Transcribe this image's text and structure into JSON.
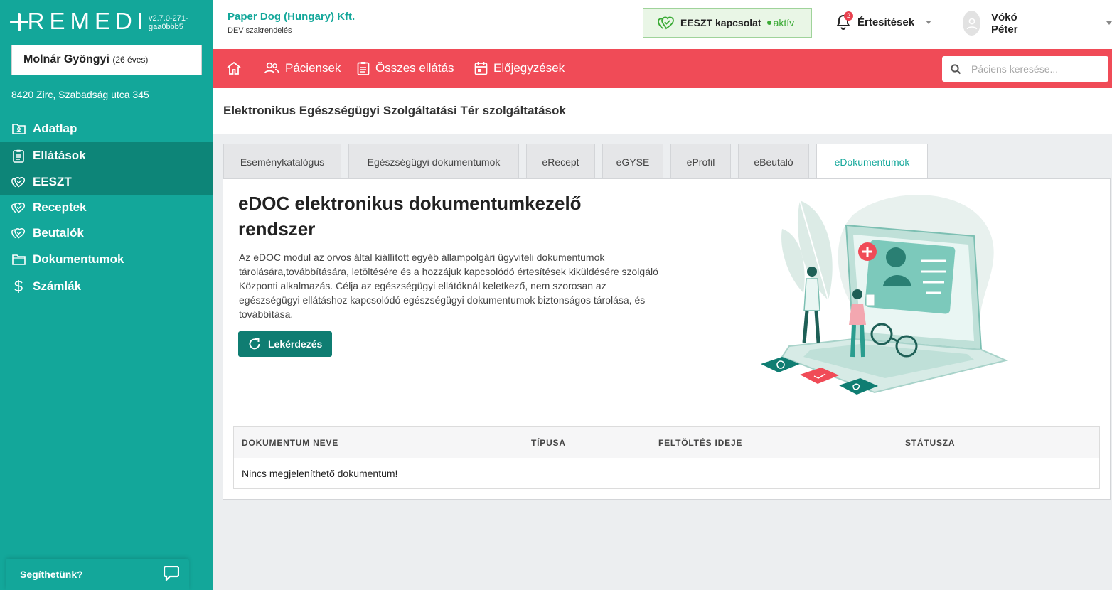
{
  "app": {
    "logo_text": "REMEDI",
    "version": "v2.7.0-271-gaa0bbb5"
  },
  "patient": {
    "name": "Molnár Gyöngyi",
    "age": "(26 éves)",
    "address": "8420 Zirc, Szabadság utca 345"
  },
  "sidebar": {
    "items": [
      {
        "label": "Adatlap",
        "icon": "folder-user-icon"
      },
      {
        "label": "Ellátások",
        "icon": "clipboard-icon"
      },
      {
        "label": "EESZT",
        "icon": "heart-check-icon"
      },
      {
        "label": "Receptek",
        "icon": "heart-check-icon"
      },
      {
        "label": "Beutalók",
        "icon": "heart-check-icon"
      },
      {
        "label": "Dokumentumok",
        "icon": "folder-icon"
      },
      {
        "label": "Számlák",
        "icon": "dollar-icon"
      }
    ],
    "help_label": "Segíthetünk?"
  },
  "header": {
    "org_name": "Paper Dog (Hungary) Kft.",
    "org_sub": "DEV szakrendelés",
    "eeszt_label": "EESZT kapcsolat",
    "eeszt_status": "aktív",
    "notifications_label": "Értesítések",
    "notifications_count": "2",
    "user_name": "Vókó Péter"
  },
  "nav": {
    "items": [
      "Páciensek",
      "Összes ellátás",
      "Előjegyzések"
    ],
    "search_placeholder": "Páciens keresése..."
  },
  "page": {
    "title": "Elektronikus Egészségügyi Szolgáltatási Tér szolgáltatások"
  },
  "tabs": [
    "Eseménykatalógus",
    "Egészségügyi dokumentumok",
    "eRecept",
    "eGYSE",
    "eProfil",
    "eBeutaló",
    "eDokumentumok"
  ],
  "active_tab": "eDokumentumok",
  "panel": {
    "title": "eDOC elektronikus dokumentumkezelő rendszer",
    "description": "Az eDOC modul az orvos által kiállított egyéb állampolgári ügyviteli dokumentumok tárolására,továbbítására, letöltésére és a hozzájuk kapcsolódó értesítések kiküldésére szolgáló Központi alkalmazás. Célja az egészségügyi ellátóknál keletkező, nem szorosan az egészségügyi ellátáshoz kapcsolódó egészségügyi dokumentumok biztonságos tárolása, és továbbítása.",
    "query_button": "Lekérdezés"
  },
  "table": {
    "columns": [
      "DOKUMENTUM NEVE",
      "TÍPUSA",
      "FELTÖLTÉS IDEJE",
      "STÁTUSZA"
    ],
    "empty_text": "Nincs megjeleníthető dokumentum!"
  },
  "colors": {
    "primary": "#13a79a",
    "primary_dark": "#0d8578",
    "nav_red": "#f04b57",
    "status_green": "#3aaa35"
  }
}
